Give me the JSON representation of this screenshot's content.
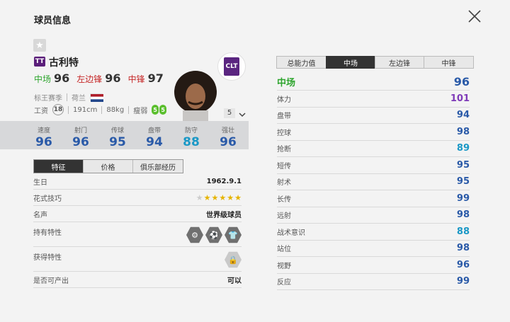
{
  "header": {
    "title": "球员信息"
  },
  "player": {
    "tier_badge": "TT",
    "name": "古利特",
    "positions": [
      {
        "label": "中场",
        "value": "96",
        "color": "#2ea52e"
      },
      {
        "label": "左边锋",
        "value": "96",
        "color": "#c62828"
      },
      {
        "label": "中锋",
        "value": "97",
        "color": "#c62828"
      }
    ],
    "season": "标王赛季",
    "nationality": "荷兰",
    "salary_label": "工资",
    "salary": "18",
    "height": "191cm",
    "weight": "88kg",
    "body_type": "瘦弱",
    "weak_foot": [
      "5",
      "5"
    ],
    "level": "5",
    "club_badge_text": "CLT"
  },
  "stats": [
    {
      "label": "速度",
      "value": "96"
    },
    {
      "label": "射门",
      "value": "96"
    },
    {
      "label": "传球",
      "value": "95"
    },
    {
      "label": "盘带",
      "value": "94"
    },
    {
      "label": "防守",
      "value": "88"
    },
    {
      "label": "强壮",
      "value": "96"
    }
  ],
  "left_tabs": [
    "特征",
    "价格",
    "俱乐部经历"
  ],
  "info": {
    "birthday_label": "生日",
    "birthday": "1962.9.1",
    "skill_label": "花式技巧",
    "skill_stars": 5,
    "fame_label": "名声",
    "fame": "世界级球员",
    "traits_label": "持有特性",
    "gained_label": "获得特性",
    "tradable_label": "是否可产出",
    "tradable": "可以"
  },
  "right_tabs": [
    "总能力值",
    "中场",
    "左边锋",
    "中锋"
  ],
  "ability": {
    "head_label": "中场",
    "head_value": "96",
    "rows": [
      {
        "label": "体力",
        "value": "101",
        "style": "purple"
      },
      {
        "label": "盘带",
        "value": "94",
        "style": ""
      },
      {
        "label": "控球",
        "value": "98",
        "style": ""
      },
      {
        "label": "抢断",
        "value": "89",
        "style": "cyan"
      },
      {
        "label": "短传",
        "value": "95",
        "style": ""
      },
      {
        "label": "射术",
        "value": "95",
        "style": ""
      },
      {
        "label": "长传",
        "value": "99",
        "style": ""
      },
      {
        "label": "远射",
        "value": "98",
        "style": ""
      },
      {
        "label": "战术意识",
        "value": "88",
        "style": "cyan"
      },
      {
        "label": "站位",
        "value": "98",
        "style": ""
      },
      {
        "label": "视野",
        "value": "96",
        "style": ""
      },
      {
        "label": "反应",
        "value": "99",
        "style": ""
      }
    ]
  },
  "colors": {
    "accent_blue": "#2a5aa8",
    "green": "#2ea52e",
    "red": "#c62828",
    "purple": "#7e3ab8",
    "cyan": "#1a98c6"
  }
}
